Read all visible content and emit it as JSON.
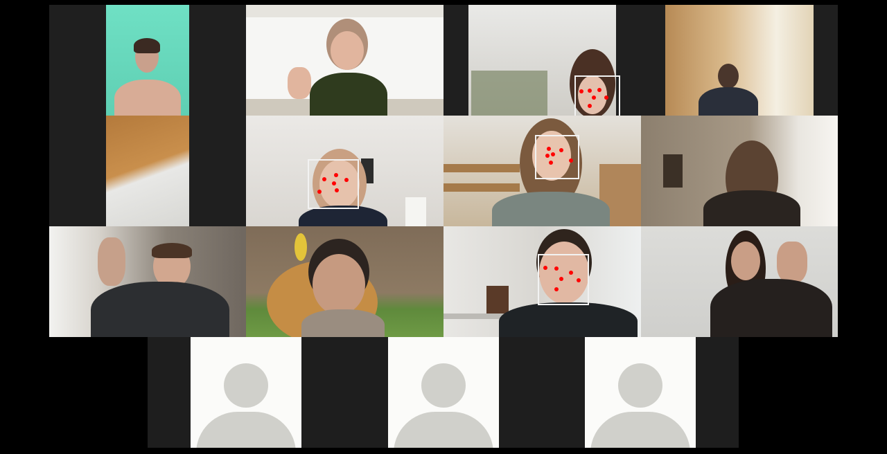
{
  "meeting": {
    "layout": "gallery",
    "participant_count": 15,
    "colors": {
      "background": "#000000",
      "tile_border": "#1f1f1f",
      "face_box": "#f2f2f2",
      "landmark_dot": "#ff0000",
      "avatar_card": "#fbfbf9",
      "avatar_silhouette": "#d0d0cb"
    }
  },
  "video_tiles": [
    {
      "id": "r1c1",
      "face_detected": false
    },
    {
      "id": "r1c2",
      "face_detected": false
    },
    {
      "id": "r1c3",
      "face_detected": true,
      "landmarks": 6
    },
    {
      "id": "r1c4",
      "face_detected": false
    },
    {
      "id": "r2c1",
      "face_detected": false
    },
    {
      "id": "r2c2",
      "face_detected": true,
      "landmarks": 6
    },
    {
      "id": "r2c3",
      "face_detected": true,
      "landmarks": 6
    },
    {
      "id": "r2c4",
      "face_detected": false
    },
    {
      "id": "r3c1",
      "face_detected": false
    },
    {
      "id": "r3c2",
      "face_detected": false
    },
    {
      "id": "r3c3",
      "face_detected": true,
      "landmarks": 6
    },
    {
      "id": "r3c4",
      "face_detected": false
    }
  ],
  "avatar_tiles": [
    {
      "id": "r4c1",
      "icon": "user-silhouette-icon"
    },
    {
      "id": "r4c2",
      "icon": "user-silhouette-icon"
    },
    {
      "id": "r4c3",
      "icon": "user-silhouette-icon"
    }
  ]
}
